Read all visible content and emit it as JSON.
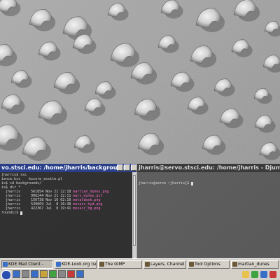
{
  "left_terminal": {
    "title": "vo.stsci.edu: /home/jharris/backgrounds - K",
    "lines": [
      {
        "t": "jharris$ ssc",
        "c": ""
      },
      {
        "t": "ience.kss    kscore_exsite.pl",
        "c": ""
      },
      {
        "t": "is$ cd backgrounds/",
        "c": ""
      },
      {
        "t": "is$ dir *",
        "c": ""
      },
      {
        "t": "  jharris     561854 Nov 21 12:18 ",
        "c": "",
        "p": "martian_dunes.png"
      },
      {
        "t": "  jharris     906244 Nov 21 12:11 ",
        "c": "",
        "p": "mars_dunes.gif"
      },
      {
        "t": "  jharris     156738 Nov 16 02:10 ",
        "c": "",
        "p": "metaldesk.png"
      },
      {
        "t": "  jharris     539069 Jul  8 16:38 ",
        "c": "",
        "p": "mosaic_hyd.png"
      },
      {
        "t": "  jharris     422367 Jul  8 19:41 ",
        "c": "",
        "p": "mosaic_bg.png"
      },
      {
        "t": "rounds]$ ",
        "c": ""
      }
    ]
  },
  "right_terminal": {
    "title": "jharris@servo.stsci.edu: /home/jharris - Djuma",
    "prompt": "jharris@servo ~jharris]$ "
  },
  "taskbar": {
    "tasks": [
      {
        "label": "KDE Mail Client -",
        "color": "#3a6fc8"
      },
      {
        "label": "KDE-Look.org (sc",
        "color": "#3a6fc8"
      },
      {
        "label": "The GIMP",
        "color": "#6b5a3a"
      },
      {
        "label": "Layers, Channel",
        "color": "#6b5a3a"
      },
      {
        "label": "Tool Options",
        "color": "#6b5a3a"
      },
      {
        "label": "martian_dunes",
        "color": "#6b5a3a"
      }
    ],
    "tray_colors": [
      "#e8c24a",
      "#3fa33f",
      "#3a6fc8",
      "#c83a3a"
    ],
    "launcher_colors": [
      "#3a6fc8",
      "#888888",
      "#3a6fc8",
      "#c8a33a",
      "#3fa33f",
      "#888888",
      "#c83a3a",
      "#3a6fc8"
    ]
  },
  "icons": [
    "kde-menu-icon",
    "terminal-icon",
    "gimp-icon",
    "mail-icon",
    "browser-icon",
    "clock-icon"
  ]
}
